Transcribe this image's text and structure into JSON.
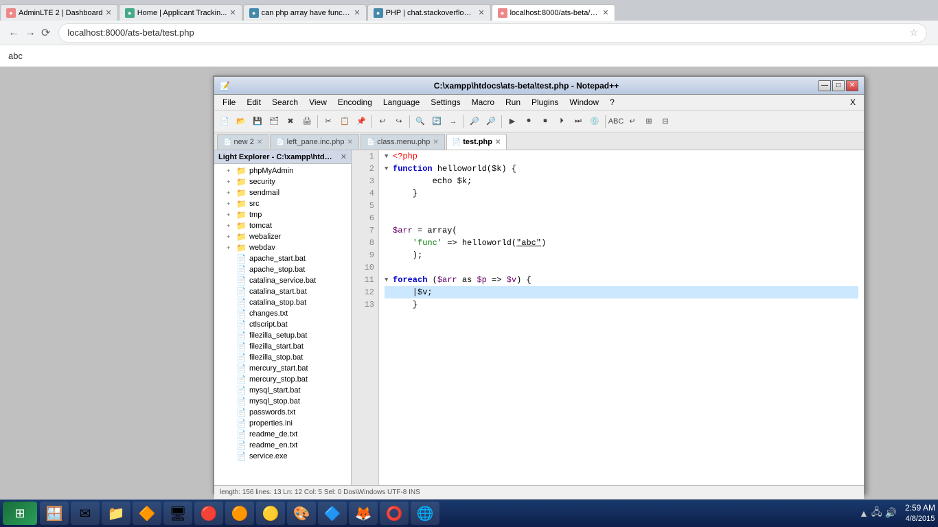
{
  "browser": {
    "address": "localhost:8000/ats-beta/test.php",
    "tabs": [
      {
        "id": "tab1",
        "favicon_color": "#e88",
        "title": "AdminLTE 2 | Dashboard",
        "active": false
      },
      {
        "id": "tab2",
        "favicon_color": "#4a8",
        "title": "Home | Applicant Trackin...",
        "active": false
      },
      {
        "id": "tab3",
        "favicon_color": "#48a",
        "title": "can php array have functi...",
        "active": false
      },
      {
        "id": "tab4",
        "favicon_color": "#48a",
        "title": "PHP | chat.stackoverflow.c...",
        "active": false
      },
      {
        "id": "tab5",
        "favicon_color": "#e88",
        "title": "localhost:8000/ats-beta/te...",
        "active": true
      }
    ]
  },
  "page": {
    "content": "abc"
  },
  "notepad": {
    "title": "C:\\xampp\\htdocs\\ats-beta\\test.php - Notepad++",
    "menu": [
      "File",
      "Edit",
      "Search",
      "View",
      "Encoding",
      "Language",
      "Settings",
      "Macro",
      "Run",
      "Plugins",
      "Window",
      "?"
    ],
    "tabs": [
      {
        "label": "new  2",
        "active": false,
        "modified": true
      },
      {
        "label": "left_pane.inc.php",
        "active": false,
        "modified": false
      },
      {
        "label": "class.menu.php",
        "active": false,
        "modified": false
      },
      {
        "label": "test.php",
        "active": true,
        "modified": false
      }
    ],
    "explorer": {
      "title": "Light Explorer - C:\\xampp\\htdocs\\at...",
      "items": [
        {
          "type": "folder",
          "label": "phpMyAdmin",
          "indent": 1,
          "expanded": false
        },
        {
          "type": "folder",
          "label": "security",
          "indent": 1,
          "expanded": false
        },
        {
          "type": "folder",
          "label": "sendmail",
          "indent": 1,
          "expanded": false
        },
        {
          "type": "folder",
          "label": "src",
          "indent": 1,
          "expanded": false
        },
        {
          "type": "folder",
          "label": "tmp",
          "indent": 1,
          "expanded": false
        },
        {
          "type": "folder",
          "label": "tomcat",
          "indent": 1,
          "expanded": false
        },
        {
          "type": "folder",
          "label": "webalizer",
          "indent": 1,
          "expanded": false
        },
        {
          "type": "folder",
          "label": "webdav",
          "indent": 1,
          "expanded": false
        },
        {
          "type": "file",
          "label": "apache_start.bat",
          "indent": 1
        },
        {
          "type": "file",
          "label": "apache_stop.bat",
          "indent": 1
        },
        {
          "type": "file",
          "label": "catalina_service.bat",
          "indent": 1
        },
        {
          "type": "file",
          "label": "catalina_start.bat",
          "indent": 1
        },
        {
          "type": "file",
          "label": "catalina_stop.bat",
          "indent": 1
        },
        {
          "type": "file",
          "label": "changes.txt",
          "indent": 1
        },
        {
          "type": "file",
          "label": "ctlscript.bat",
          "indent": 1
        },
        {
          "type": "file",
          "label": "filezilla_setup.bat",
          "indent": 1
        },
        {
          "type": "file",
          "label": "filezilla_start.bat",
          "indent": 1
        },
        {
          "type": "file",
          "label": "filezilla_stop.bat",
          "indent": 1
        },
        {
          "type": "file",
          "label": "mercury_start.bat",
          "indent": 1
        },
        {
          "type": "file",
          "label": "mercury_stop.bat",
          "indent": 1
        },
        {
          "type": "file",
          "label": "mysql_start.bat",
          "indent": 1
        },
        {
          "type": "file",
          "label": "mysql_stop.bat",
          "indent": 1
        },
        {
          "type": "file",
          "label": "passwords.txt",
          "indent": 1
        },
        {
          "type": "file",
          "label": "properties.ini",
          "indent": 1
        },
        {
          "type": "file",
          "label": "readme_de.txt",
          "indent": 1
        },
        {
          "type": "file",
          "label": "readme_en.txt",
          "indent": 1
        },
        {
          "type": "file",
          "label": "service.exe",
          "indent": 1
        }
      ]
    },
    "lines": [
      {
        "num": 1,
        "fold": true,
        "tokens": [
          {
            "type": "kw-open",
            "text": "<?php"
          }
        ]
      },
      {
        "num": 2,
        "fold": true,
        "tokens": [
          {
            "type": "kw-blue",
            "text": "function"
          },
          {
            "type": "kw-black",
            "text": " "
          },
          {
            "type": "kw-black",
            "text": "helloworld"
          },
          {
            "type": "kw-black",
            "text": "($k) {"
          }
        ]
      },
      {
        "num": 3,
        "fold": false,
        "tokens": [
          {
            "type": "kw-black",
            "text": "        echo $k;"
          }
        ]
      },
      {
        "num": 4,
        "fold": false,
        "tokens": [
          {
            "type": "kw-black",
            "text": "    }"
          }
        ]
      },
      {
        "num": 5,
        "fold": false,
        "tokens": []
      },
      {
        "num": 6,
        "fold": false,
        "tokens": []
      },
      {
        "num": 7,
        "fold": false,
        "tokens": [
          {
            "type": "kw-var",
            "text": "$arr"
          },
          {
            "type": "kw-black",
            "text": " = "
          },
          {
            "type": "kw-black",
            "text": "array("
          }
        ]
      },
      {
        "num": 8,
        "fold": false,
        "tokens": [
          {
            "type": "kw-string",
            "text": "    'func'"
          },
          {
            "type": "kw-black",
            "text": " => "
          },
          {
            "type": "kw-black",
            "text": "helloworld("
          },
          {
            "type": "kw-underline",
            "text": "\"abc\""
          },
          {
            "type": "kw-black",
            "text": ")"
          }
        ]
      },
      {
        "num": 9,
        "fold": false,
        "tokens": [
          {
            "type": "kw-black",
            "text": "    );"
          }
        ]
      },
      {
        "num": 10,
        "fold": false,
        "tokens": []
      },
      {
        "num": 11,
        "fold": true,
        "tokens": [
          {
            "type": "kw-blue",
            "text": "foreach"
          },
          {
            "type": "kw-black",
            "text": " ("
          },
          {
            "type": "kw-var",
            "text": "$arr"
          },
          {
            "type": "kw-black",
            "text": " as "
          },
          {
            "type": "kw-var",
            "text": "$p"
          },
          {
            "type": "kw-black",
            "text": " => "
          },
          {
            "type": "kw-var",
            "text": "$v"
          },
          {
            "type": "kw-black",
            "text": ") {"
          }
        ]
      },
      {
        "num": 12,
        "fold": false,
        "highlighted": true,
        "tokens": [
          {
            "type": "kw-black",
            "text": "    |$v;"
          }
        ]
      },
      {
        "num": 13,
        "fold": false,
        "tokens": [
          {
            "type": "kw-black",
            "text": "    }"
          }
        ]
      }
    ]
  },
  "taskbar": {
    "apps": [
      {
        "icon": "🪟",
        "name": "start"
      },
      {
        "icon": "✉",
        "name": "mail"
      },
      {
        "icon": "📁",
        "name": "explorer"
      },
      {
        "icon": "🔶",
        "name": "xampp"
      },
      {
        "icon": "🖥",
        "name": "skype"
      },
      {
        "icon": "🔴",
        "name": "visual-studio"
      },
      {
        "icon": "🟠",
        "name": "app6"
      },
      {
        "icon": "🟡",
        "name": "filezilla"
      },
      {
        "icon": "🎨",
        "name": "photoshop"
      },
      {
        "icon": "🔷",
        "name": "notepad"
      },
      {
        "icon": "🦊",
        "name": "firefox"
      },
      {
        "icon": "⭕",
        "name": "opera"
      },
      {
        "icon": "🌐",
        "name": "chrome"
      }
    ],
    "tray": {
      "time": "2:59 AM",
      "date": "4/8/2015"
    }
  }
}
